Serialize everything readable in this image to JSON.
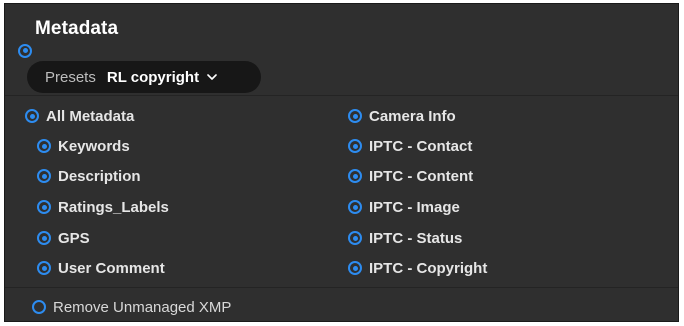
{
  "panel": {
    "title": "Metadata",
    "title_selected": true
  },
  "presets": {
    "label": "Presets",
    "value": "RL copyright",
    "icon": "chevron-down-icon"
  },
  "left_options": [
    {
      "label": "All Metadata",
      "selected": true
    },
    {
      "label": "Keywords",
      "selected": true
    },
    {
      "label": "Description",
      "selected": true
    },
    {
      "label": "Ratings_Labels",
      "selected": true
    },
    {
      "label": "GPS",
      "selected": true
    },
    {
      "label": "User Comment",
      "selected": true
    }
  ],
  "right_options": [
    {
      "label": "Camera Info",
      "selected": true
    },
    {
      "label": "IPTC - Contact",
      "selected": true
    },
    {
      "label": "IPTC - Content",
      "selected": true
    },
    {
      "label": "IPTC - Image",
      "selected": true
    },
    {
      "label": "IPTC - Status",
      "selected": true
    },
    {
      "label": "IPTC - Copyright",
      "selected": true
    }
  ],
  "footer": {
    "label": "Remove Unmanaged XMP",
    "selected": false
  },
  "colors": {
    "accent": "#2d8cf0",
    "panel_bg": "#2f2f2f",
    "pill_bg": "#171717"
  }
}
